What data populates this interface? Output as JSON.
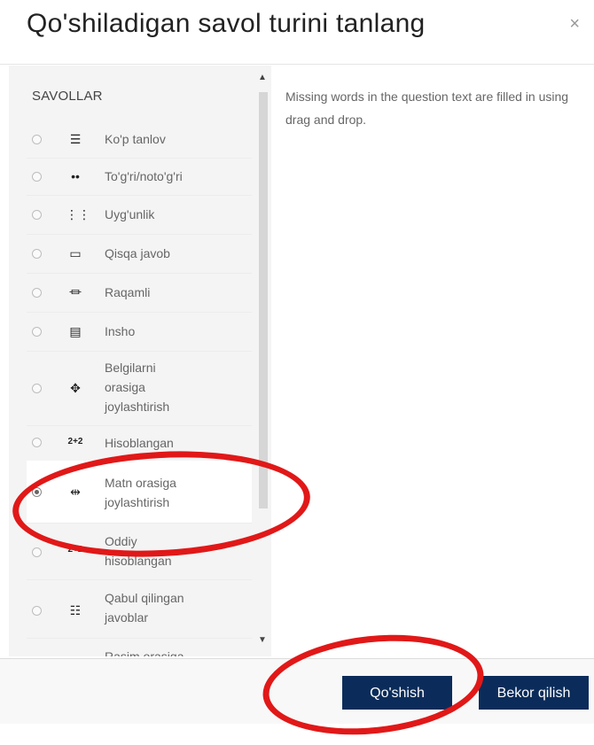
{
  "header": {
    "title": "Qo'shiladigan savol turini tanlang",
    "close_label": "×"
  },
  "left": {
    "section_title": "SAVOLLAR",
    "items": [
      {
        "label": "Ko'p tanlov",
        "icon": "list-icon",
        "icon_char": "☰"
      },
      {
        "label": "To'g'ri/noto'g'ri",
        "icon": "dots-icon",
        "icon_char": "••"
      },
      {
        "label": "Uyg'unlik",
        "icon": "grid-icon",
        "icon_char": "⋮⋮"
      },
      {
        "label": "Qisqa javob",
        "icon": "rectangle-icon",
        "icon_char": "▭"
      },
      {
        "label": "Raqamli",
        "icon": "numerical-icon",
        "icon_char": "⏛"
      },
      {
        "label": "Insho",
        "icon": "essay-icon",
        "icon_char": "▤"
      },
      {
        "label": "Belgilarni\norasiga\njoylashtirish",
        "icon": "move-icon",
        "icon_char": "✥"
      },
      {
        "label": "Hisoblangan",
        "icon": "calculated-icon",
        "icon_char": "2+2"
      },
      {
        "label": "Matn orasiga\njoylashtirish",
        "icon": "drag-text-icon",
        "icon_char": "⇹"
      },
      {
        "label": "Oddiy\nhisoblangan",
        "icon": "simple-calculated-icon",
        "icon_char": "2+2"
      },
      {
        "label": "Qabul qilingan\njavoblar",
        "icon": "multianswer-icon",
        "icon_char": "☷"
      },
      {
        "label": "Rasim orasiga",
        "icon": "image-drag-icon",
        "icon_char": ""
      }
    ]
  },
  "right": {
    "description": "Missing words in the question text are filled in using drag and drop."
  },
  "footer": {
    "add_label": "Qo'shish",
    "cancel_label": "Bekor qilish"
  }
}
